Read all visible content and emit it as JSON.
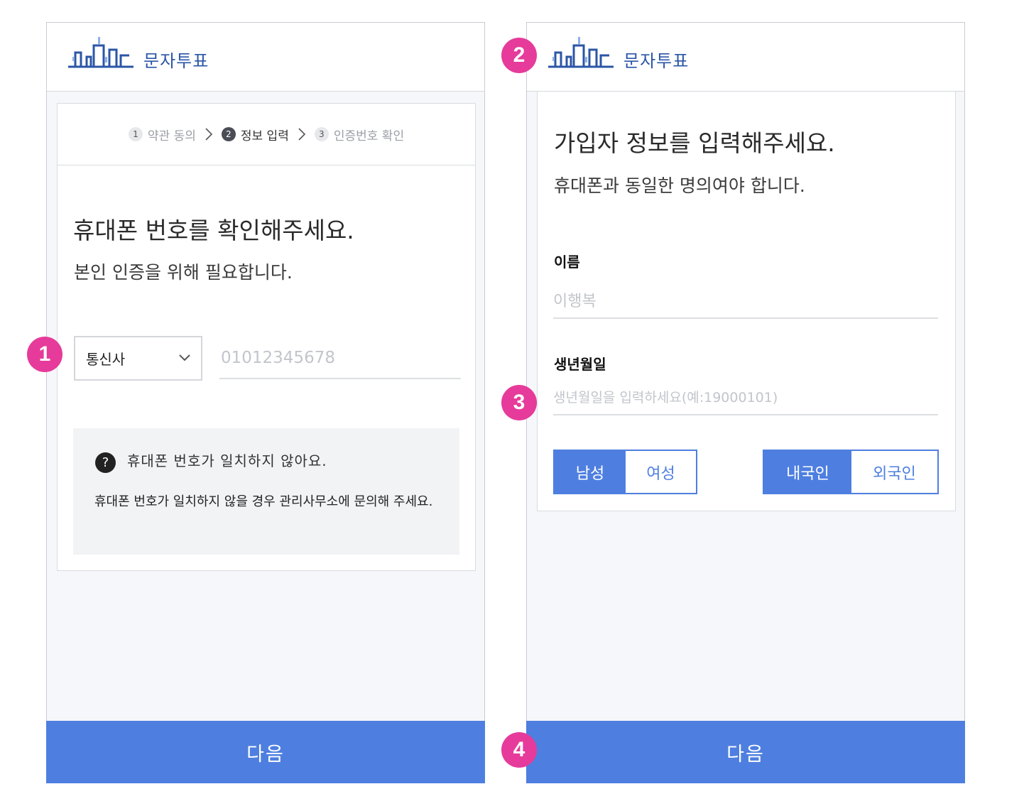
{
  "left_screen": {
    "app_title": "문자투표",
    "steps": [
      {
        "num": "1",
        "label": "약관 동의"
      },
      {
        "num": "2",
        "label": "정보 입력"
      },
      {
        "num": "3",
        "label": "인증번호 확인"
      }
    ],
    "heading": "휴대폰 번호를 확인해주세요.",
    "subtext": "본인 인증을 위해 필요합니다.",
    "carrier_select": "통신사",
    "phone_placeholder": "01012345678",
    "help_title": "휴대폰 번호가 일치하지 않아요.",
    "help_body": "휴대폰 번호가 일치하지 않을 경우 관리사무소에 문의해 주세요.",
    "next_label": "다음"
  },
  "right_screen": {
    "app_title": "문자투표",
    "heading": "가입자 정보를 입력해주세요.",
    "subtext": "휴대폰과 동일한 명의여야 합니다.",
    "name_label": "이름",
    "name_placeholder": "이행복",
    "birth_label": "생년월일",
    "birth_placeholder": "생년월일을 입력하세요(예:19000101)",
    "gender_options": [
      "남성",
      "여성"
    ],
    "gender_selected": "남성",
    "nationality_options": [
      "내국인",
      "외국인"
    ],
    "nationality_selected": "내국인",
    "next_label": "다음"
  },
  "markers": [
    "1",
    "2",
    "3",
    "4"
  ],
  "colors": {
    "primary": "#4e7fe0",
    "logo": "#2b56a6",
    "marker": "#e63b9a"
  }
}
